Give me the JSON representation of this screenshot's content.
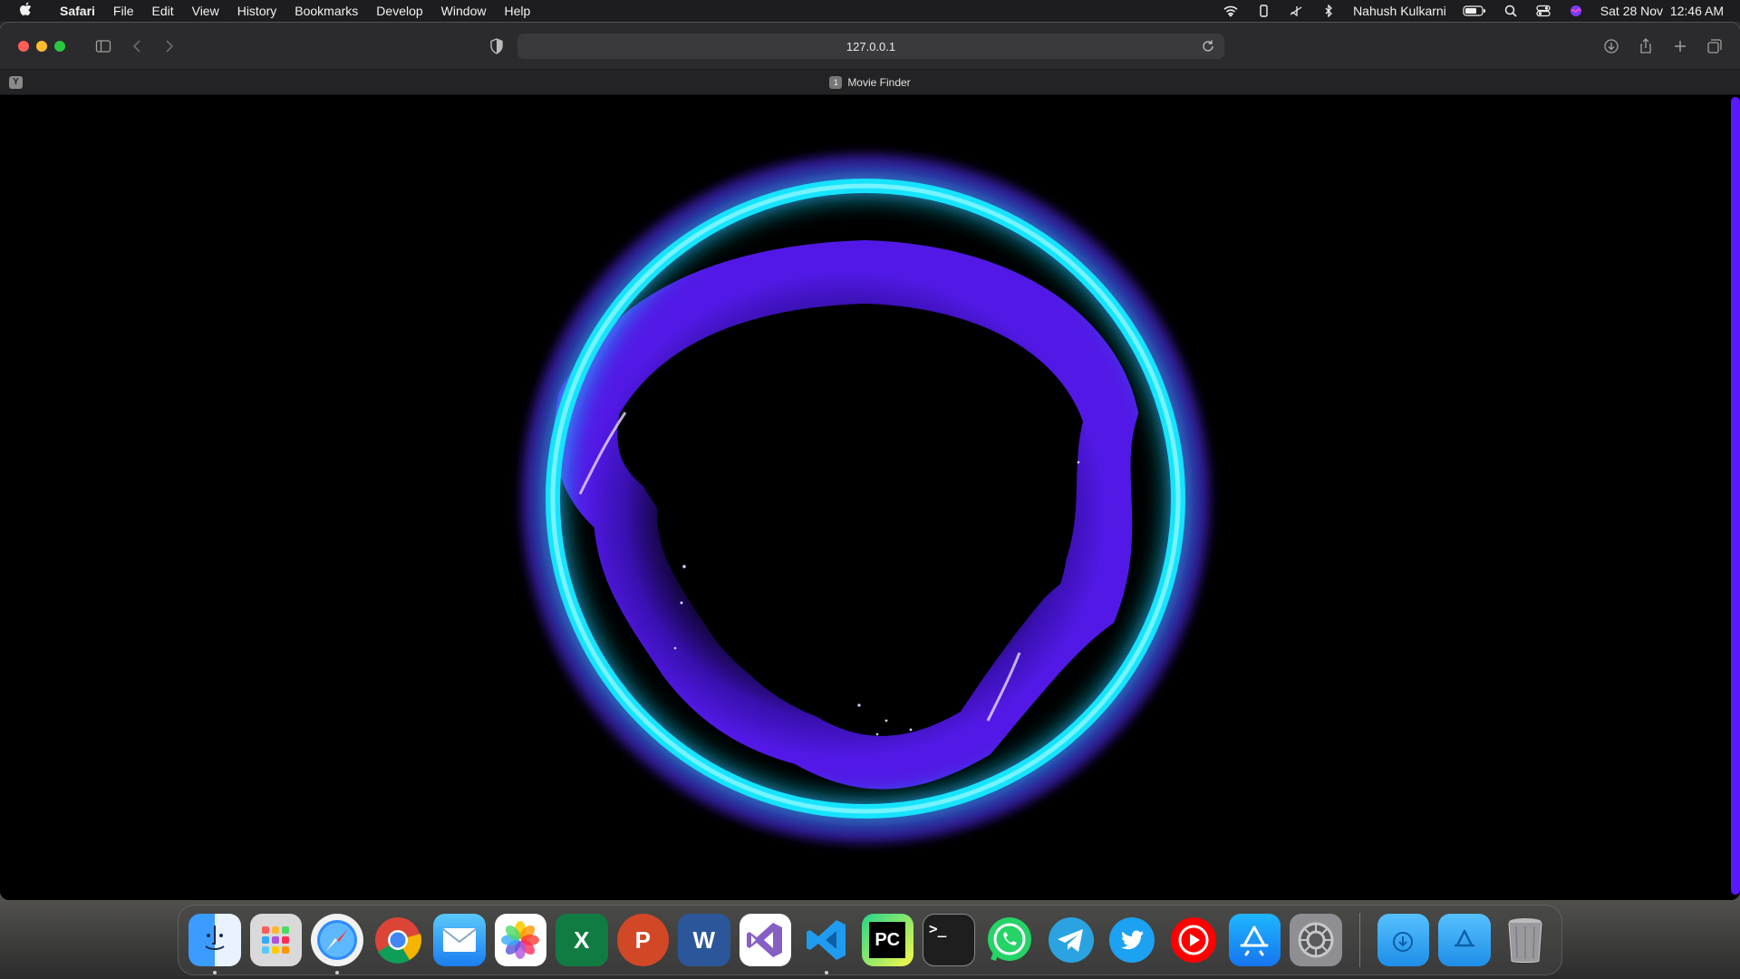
{
  "menubar": {
    "app_name": "Safari",
    "menus": [
      "File",
      "Edit",
      "View",
      "History",
      "Bookmarks",
      "Develop",
      "Window",
      "Help"
    ],
    "user_name": "Nahush Kulkarni",
    "datetime": "Sat 28 Nov  12:46 AM"
  },
  "toolbar": {
    "url": "127.0.0.1"
  },
  "tabs": {
    "pinned_label": "Y",
    "active_tab_title": "Movie Finder",
    "active_tab_favicon": "1"
  },
  "colors": {
    "ring_outer": "#18e4ff",
    "ring_inner": "#5b1cff",
    "scrollbar": "#5a1aff"
  },
  "dock": {
    "apps": [
      {
        "name": "finder-icon",
        "glyph": "",
        "running": true
      },
      {
        "name": "launchpad-icon",
        "glyph": "",
        "running": false
      },
      {
        "name": "safari-icon",
        "glyph": "",
        "running": true
      },
      {
        "name": "chrome-icon",
        "glyph": "",
        "running": false
      },
      {
        "name": "mail-icon",
        "glyph": "",
        "running": false
      },
      {
        "name": "photos-icon",
        "glyph": "",
        "running": false
      },
      {
        "name": "excel-icon",
        "glyph": "X",
        "running": false
      },
      {
        "name": "powerpoint-icon",
        "glyph": "P",
        "running": false
      },
      {
        "name": "word-icon",
        "glyph": "W",
        "running": false
      },
      {
        "name": "visual-studio-icon",
        "glyph": "",
        "running": false
      },
      {
        "name": "vscode-icon",
        "glyph": "",
        "running": true
      },
      {
        "name": "pycharm-icon",
        "glyph": "PC",
        "running": false
      },
      {
        "name": "terminal-icon",
        "glyph": ">_",
        "running": false
      },
      {
        "name": "whatsapp-icon",
        "glyph": "",
        "running": false
      },
      {
        "name": "telegram-icon",
        "glyph": "",
        "running": false
      },
      {
        "name": "twitter-icon",
        "glyph": "",
        "running": false
      },
      {
        "name": "youtube-icon",
        "glyph": "",
        "running": false
      },
      {
        "name": "app-store-icon",
        "glyph": "",
        "running": false
      },
      {
        "name": "system-preferences-icon",
        "glyph": "",
        "running": false
      }
    ]
  }
}
